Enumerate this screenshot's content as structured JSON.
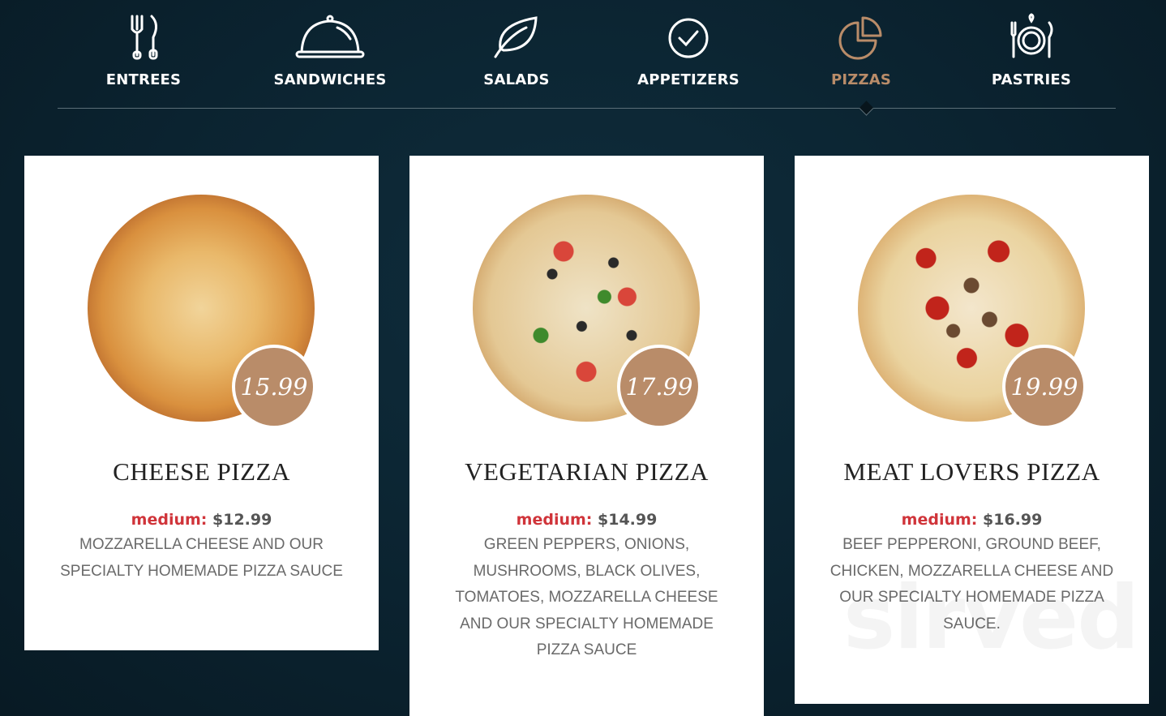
{
  "nav": {
    "tabs": [
      {
        "label": "ENTREES",
        "icon": "fork-knife-icon",
        "active": false
      },
      {
        "label": "SANDWICHES",
        "icon": "cloche-icon",
        "active": false
      },
      {
        "label": "SALADS",
        "icon": "leaf-icon",
        "active": false
      },
      {
        "label": "APPETIZERS",
        "icon": "check-circle-icon",
        "active": false
      },
      {
        "label": "PIZZAS",
        "icon": "pie-chart-icon",
        "active": true
      },
      {
        "label": "PASTRIES",
        "icon": "plate-icon",
        "active": false
      }
    ]
  },
  "menu": {
    "items": [
      {
        "name": "CHEESE PIZZA",
        "price": "15.99",
        "size_label": "medium:",
        "size_price": "$12.99",
        "description": "MOZZARELLA CHEESE AND OUR SPECIALTY HOMEMADE PIZZA SAUCE"
      },
      {
        "name": "VEGETARIAN PIZZA",
        "price": "17.99",
        "size_label": "medium:",
        "size_price": "$14.99",
        "description": "GREEN PEPPERS, ONIONS, MUSHROOMS, BLACK OLIVES, TOMATOES, MOZZARELLA CHEESE AND OUR SPECIALTY HOMEMADE PIZZA SAUCE"
      },
      {
        "name": "MEAT LOVERS PIZZA",
        "price": "19.99",
        "size_label": "medium:",
        "size_price": "$16.99",
        "description": "BEEF PEPPERONI, GROUND BEEF, CHICKEN, MOZZARELLA CHEESE AND OUR SPECIALTY HOMEMADE PIZZA SAUCE."
      }
    ]
  },
  "watermark": "sirved",
  "colors": {
    "accent": "#b98c69",
    "background": "#0b2330",
    "size_label": "#d0343a"
  }
}
